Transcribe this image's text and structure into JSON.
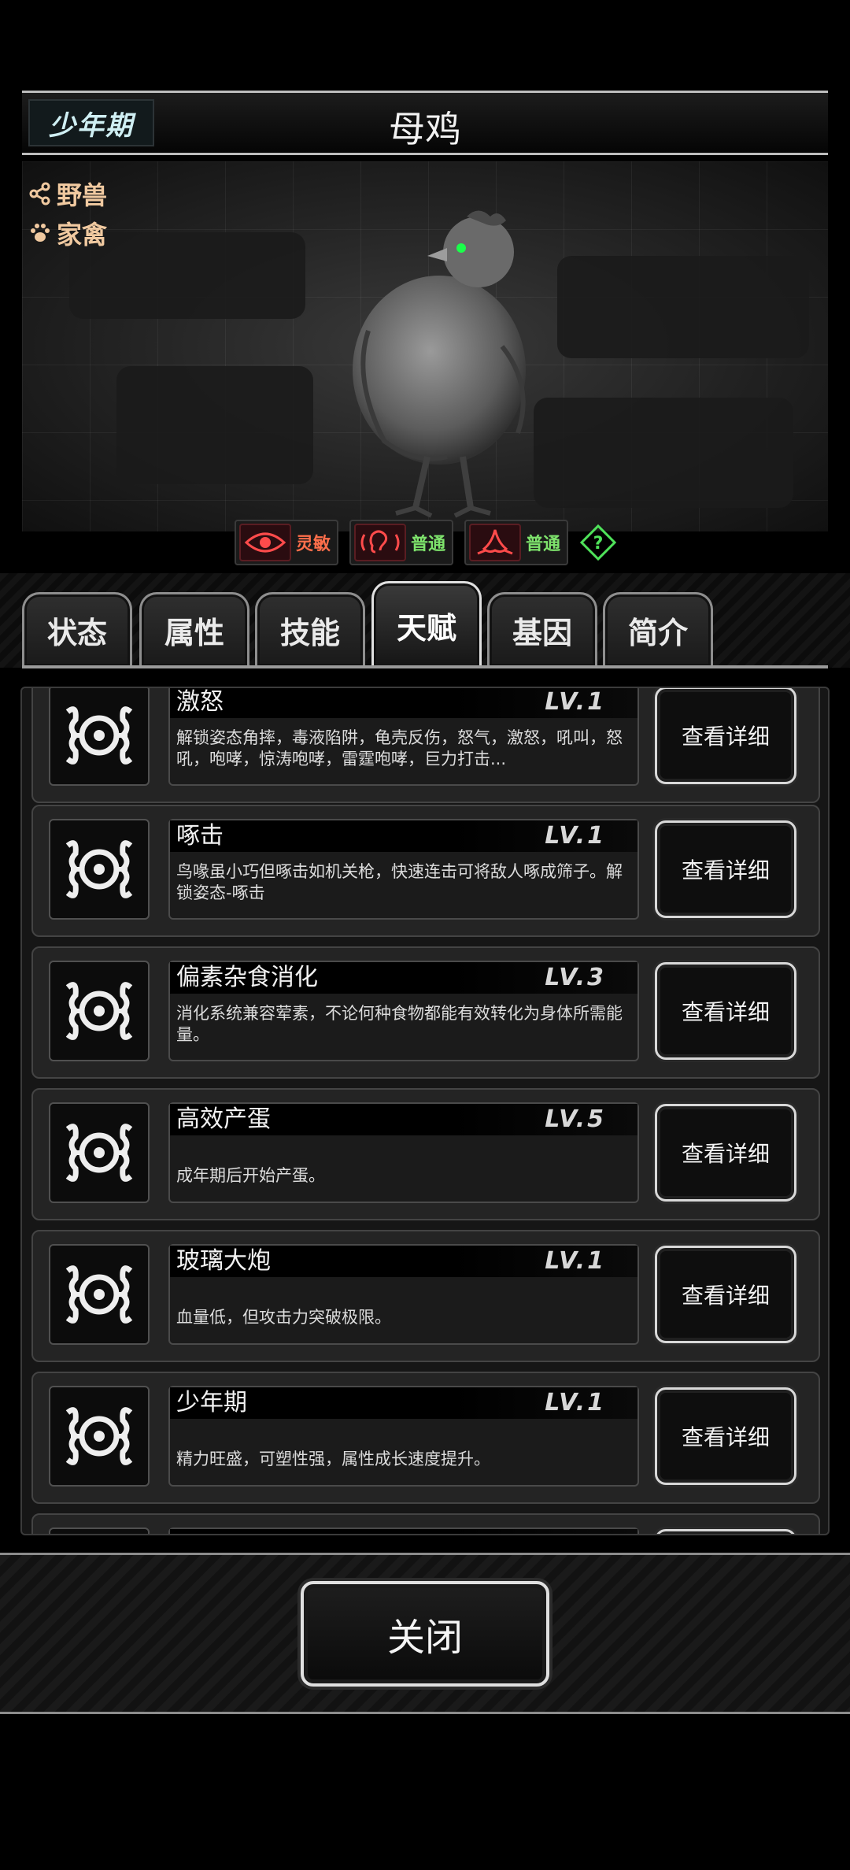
{
  "header": {
    "stage_badge": "少年期",
    "creature_name": "母鸡"
  },
  "tags": [
    {
      "label": "野兽",
      "icon": "share-branch-icon"
    },
    {
      "label": "家禽",
      "icon": "paw-icon"
    }
  ],
  "senses": [
    {
      "icon": "eye-icon",
      "label": "灵敏",
      "color": "#ff6f4b"
    },
    {
      "icon": "ear-icon",
      "label": "普通",
      "color": "#7ee36c"
    },
    {
      "icon": "nose-icon",
      "label": "普通",
      "color": "#7ee36c"
    }
  ],
  "help_icon": "question-diamond-icon",
  "tabs": [
    "状态",
    "属性",
    "技能",
    "天赋",
    "基因",
    "简介"
  ],
  "active_tab": "天赋",
  "talents": [
    {
      "name": "激怒",
      "level": "LV.1",
      "desc": "解锁姿态角摔，毒液陷阱，龟壳反伤，怒气，激怒，吼叫，怒吼，咆哮，惊涛咆哮，雷霆咆哮，巨力打击..."
    },
    {
      "name": "啄击",
      "level": "LV.1",
      "desc": "鸟喙虽小巧但啄击如机关枪，快速连击可将敌人啄成筛子。解锁姿态-啄击"
    },
    {
      "name": "偏素杂食消化",
      "level": "LV.3",
      "desc": "消化系统兼容荤素，不论何种食物都能有效转化为身体所需能量。"
    },
    {
      "name": "高效产蛋",
      "level": "LV.5",
      "desc": "成年期后开始产蛋。"
    },
    {
      "name": "玻璃大炮",
      "level": "LV.1",
      "desc": "血量低，但攻击力突破极限。"
    },
    {
      "name": "少年期",
      "level": "LV.1",
      "desc": "精力旺盛，可塑性强，属性成长速度提升。"
    }
  ],
  "detail_button_label": "查看详细",
  "close_button_label": "关闭"
}
